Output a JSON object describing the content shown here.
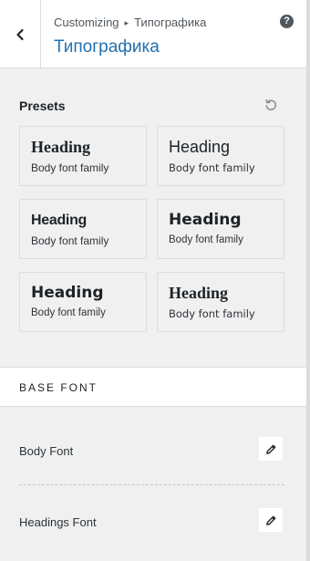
{
  "header": {
    "breadcrumb_root": "Customizing",
    "breadcrumb_sep": "▸",
    "breadcrumb_current": "Типографика",
    "title": "Типографика",
    "help_label": "?"
  },
  "presets": {
    "label": "Presets",
    "items": [
      {
        "heading": "Heading",
        "body": "Body font family"
      },
      {
        "heading": "Heading",
        "body": "Body font family"
      },
      {
        "heading": "Heading",
        "body": "Body font family"
      },
      {
        "heading": "Heading",
        "body": "Body font family"
      },
      {
        "heading": "Heading",
        "body": "Body font family"
      },
      {
        "heading": "Heading",
        "body": "Body font family"
      }
    ]
  },
  "base_font": {
    "section_title": "BASE FONT",
    "body_font_label": "Body Font",
    "headings_font_label": "Headings Font"
  },
  "colors": {
    "accent": "#2271b1",
    "panel_bg": "#f0f0f1",
    "border": "#dcdcde"
  }
}
